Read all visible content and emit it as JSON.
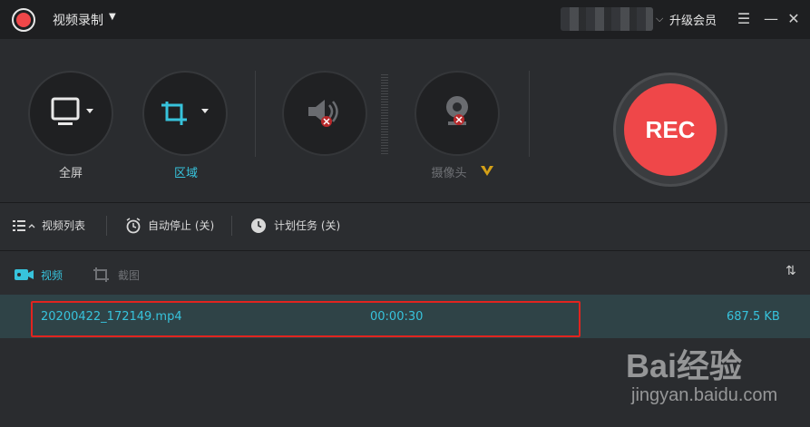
{
  "titlebar": {
    "title": "视频录制",
    "upgrade": "升级会员",
    "menu_glyph": "☰",
    "minimize_glyph": "—",
    "close_glyph": "✕"
  },
  "tools": {
    "fullscreen": "全屏",
    "region": "区域",
    "camera": "摄像头"
  },
  "record_button": "REC",
  "options": {
    "video_list": "视频列表",
    "auto_stop": "自动停止 (关)",
    "schedule": "计划任务 (关)"
  },
  "tabs": {
    "video": "视频",
    "screenshot": "截图"
  },
  "files": [
    {
      "name": "20200422_172149.mp4",
      "duration": "00:00:30",
      "size": "687.5 KB"
    }
  ],
  "watermark": {
    "brand": "Bai经验",
    "url": "jingyan.baidu.com"
  },
  "colors": {
    "accent": "#37c3dc",
    "record": "#ef4749",
    "highlight_box": "#e1241f"
  }
}
